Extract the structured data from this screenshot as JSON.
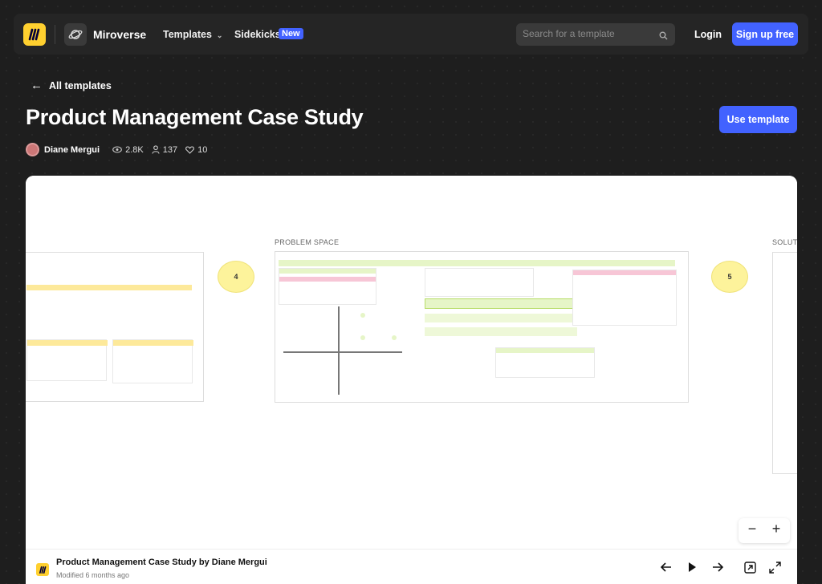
{
  "nav": {
    "brand": "Miroverse",
    "templates_label": "Templates",
    "sidekicks_label": "Sidekicks",
    "new_badge": "New",
    "search_placeholder": "Search for a template",
    "login_label": "Login",
    "signup_label": "Sign up free"
  },
  "header": {
    "back_label": "All templates",
    "title": "Product Management Case Study",
    "use_template_label": "Use template",
    "author": "Diane Mergui",
    "views": "2.8K",
    "users": "137",
    "likes": "10"
  },
  "board": {
    "problem_space_label": "PROBLEM SPACE",
    "solution_label": "SOLUT",
    "step_4": "4",
    "step_5": "5"
  },
  "footer": {
    "title": "Product Management Case Study by Diane Mergui",
    "modified": "Modified 6 months ago"
  },
  "colors": {
    "accent": "#4262ff",
    "logo_yellow": "#ffd02f",
    "sticky_yellow": "#fdf39b",
    "sticky_green": "#e6f5c7",
    "sticky_pink": "#f7c6d6"
  }
}
